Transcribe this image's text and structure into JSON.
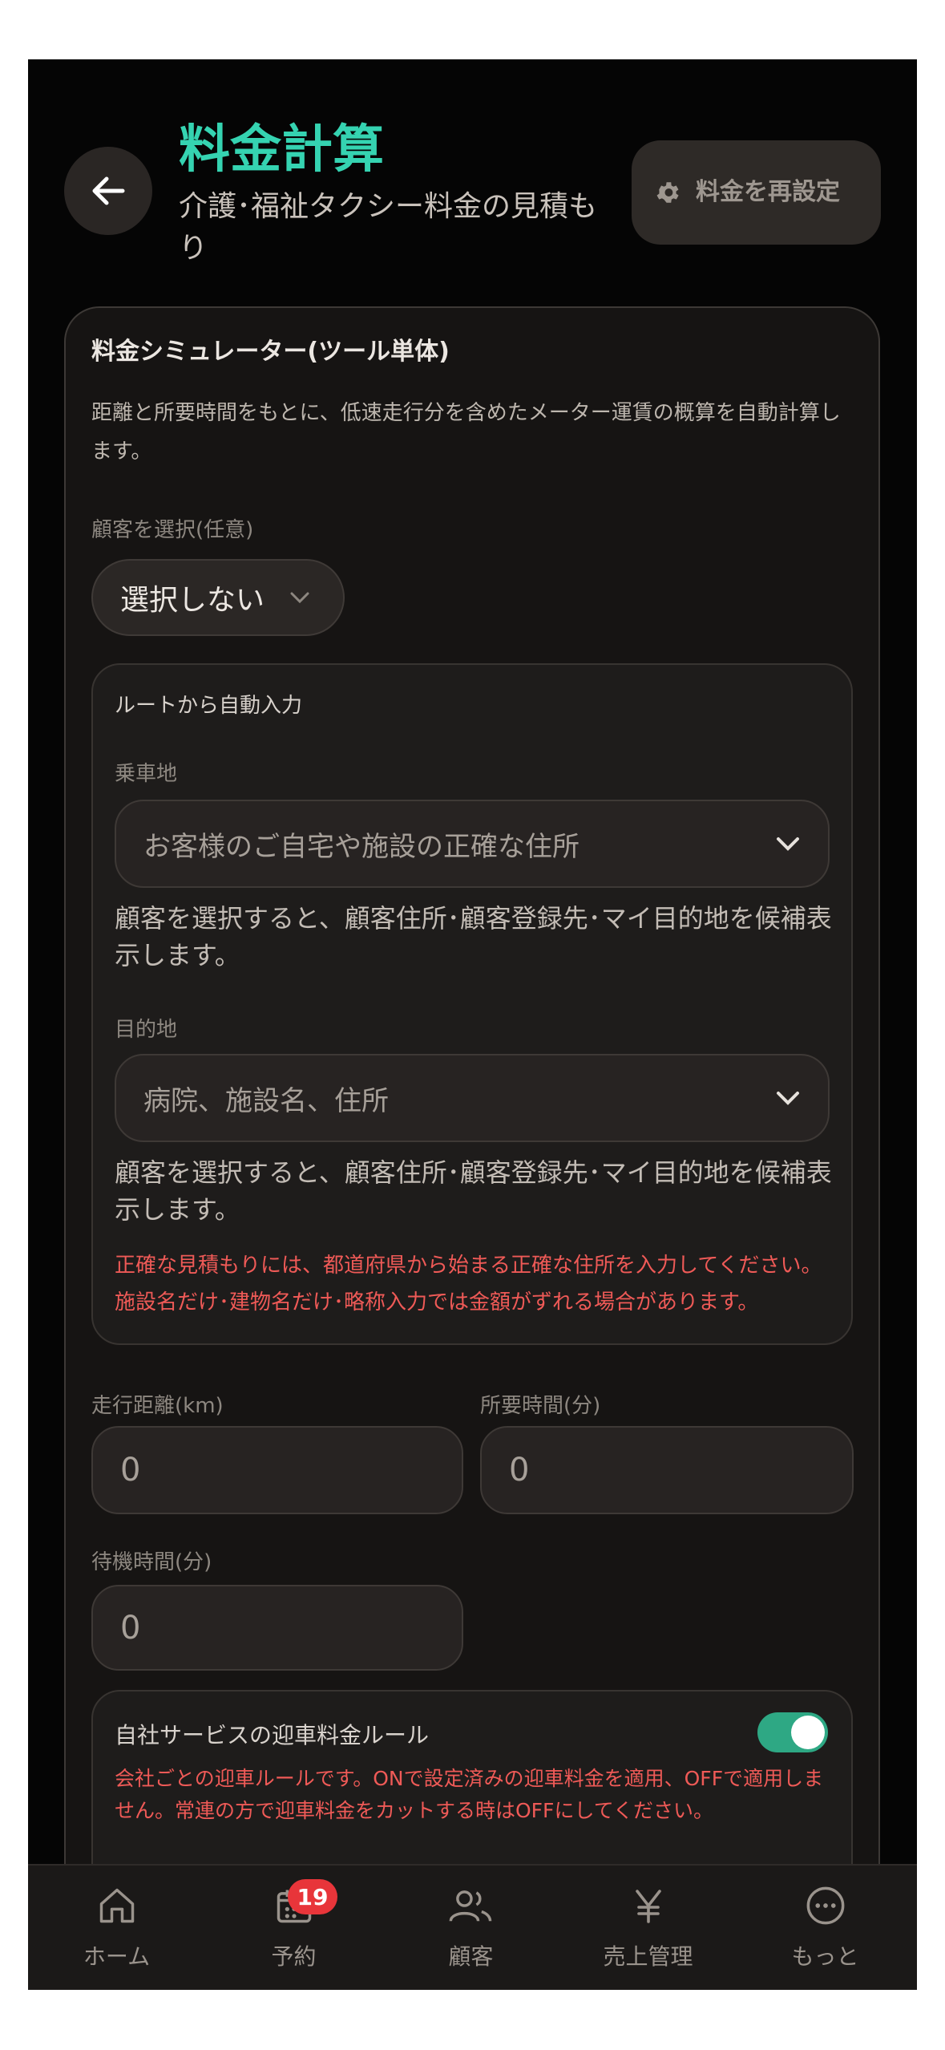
{
  "header": {
    "title": "料金計算",
    "subtitle": "介護･福祉タクシー料金の見積もり",
    "reset_label": "料金を再設定"
  },
  "simulator": {
    "title": "料金シミュレーター(ツール単体)",
    "description": "距離と所要時間をもとに、低速走行分を含めたメーター運賃の概算を自動計算します。",
    "customer_label": "顧客を選択(任意)",
    "customer_value": "選択しない",
    "route": {
      "title": "ルートから自動入力",
      "pickup_label": "乗車地",
      "pickup_placeholder": "お客様のご自宅や施設の正確な住所",
      "pickup_hint": "顧客を選択すると、顧客住所･顧客登録先･マイ目的地を候補表示します。",
      "dest_label": "目的地",
      "dest_placeholder": "病院、施設名、住所",
      "dest_hint": "顧客を選択すると、顧客住所･顧客登録先･マイ目的地を候補表示します。",
      "warning_1": "正確な見積もりには、都道府県から始まる正確な住所を入力してください。",
      "warning_2": "施設名だけ･建物名だけ･略称入力では金額がずれる場合があります。"
    },
    "distance_label": "走行距離(km)",
    "distance_value": "0",
    "duration_label": "所要時間(分)",
    "duration_value": "0",
    "wait_label": "待機時間(分)",
    "wait_value": "0",
    "pickup_rule": {
      "title": "自社サービスの迎車料金ルール",
      "enabled": true,
      "note": "会社ごとの迎車ルールです。ONで設定済みの迎車料金を適用、OFFで適用しません。常連の方で迎車料金をカットする時はOFFにしてください。"
    }
  },
  "tabbar": {
    "home": "ホーム",
    "reservations": "予約",
    "reservations_badge": "19",
    "customers": "顧客",
    "sales": "売上管理",
    "more": "もっと"
  },
  "colors": {
    "accent": "#35d3b1",
    "warning": "#ef5a57",
    "toggle_on": "#2ea884",
    "badge": "#e8353a"
  }
}
